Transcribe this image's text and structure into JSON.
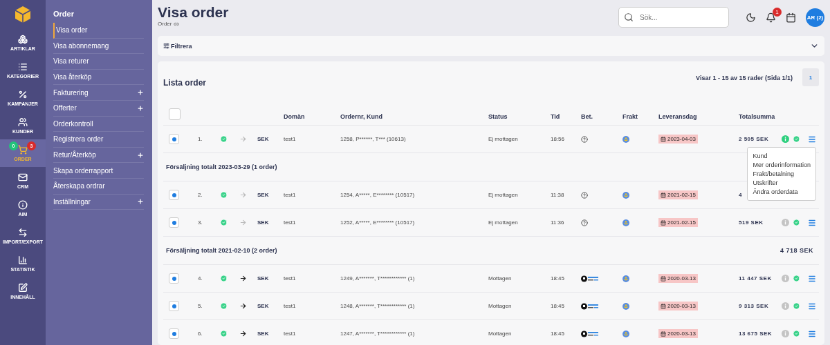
{
  "rail": {
    "items": [
      {
        "label": "ARTIKLAR",
        "selected": false
      },
      {
        "label": "KATEGORIER",
        "selected": false
      },
      {
        "label": "KAMPANJER",
        "selected": false
      },
      {
        "label": "KUNDER",
        "selected": false
      },
      {
        "label": "ORDER",
        "selected": true,
        "badges": [
          {
            "text": "0",
            "color": "#22c47a"
          },
          {
            "text": "3",
            "color": "#d92b2b"
          }
        ]
      },
      {
        "label": "CRM",
        "selected": false
      },
      {
        "label": "AIM",
        "selected": false
      },
      {
        "label": "IMPORT/EXPORT",
        "selected": false
      },
      {
        "label": "STATISTIK",
        "selected": false
      },
      {
        "label": "INNEHÅLL",
        "selected": false
      }
    ]
  },
  "submenu": {
    "title": "Order",
    "items": [
      {
        "label": "Visa order",
        "selected": true,
        "expandable": false
      },
      {
        "label": "Visa abonnemang",
        "selected": false,
        "expandable": false
      },
      {
        "label": "Visa returer",
        "selected": false,
        "expandable": false
      },
      {
        "label": "Visa återköp",
        "selected": false,
        "expandable": false
      },
      {
        "label": "Fakturering",
        "selected": false,
        "expandable": true
      },
      {
        "label": "Offerter",
        "selected": false,
        "expandable": true
      },
      {
        "label": "Orderkontroll",
        "selected": false,
        "expandable": false
      },
      {
        "label": "Registrera order",
        "selected": false,
        "expandable": false
      },
      {
        "label": "Retur/Återköp",
        "selected": false,
        "expandable": true
      },
      {
        "label": "Skapa orderrapport",
        "selected": false,
        "expandable": false
      },
      {
        "label": "Återskapa ordrar",
        "selected": false,
        "expandable": false
      },
      {
        "label": "Inställningar",
        "selected": false,
        "expandable": true
      }
    ]
  },
  "header": {
    "title": "Visa order",
    "breadcrumb": "Order",
    "search": {
      "placeholder": "Sök..."
    },
    "notifications": "1",
    "avatar": "AR (2)"
  },
  "filter": {
    "label": "Filtrera",
    "expanded": false
  },
  "list": {
    "title": "Lista order",
    "summary": "Visar 1 - 15 av 15 rader (Sida 1/1)",
    "pages": [
      {
        "label": "1",
        "selected": true
      }
    ],
    "header_checked": false,
    "columns": [
      "Domän",
      "Ordernr, Kund",
      "Status",
      "Tid",
      "Bet.",
      "Frakt",
      "Leveransdag",
      "Totalsumma"
    ],
    "sections": [
      {
        "kind": "row",
        "checked": true,
        "number": "1.",
        "arrow_active": false,
        "currency": "SEK",
        "domain": "test1",
        "order": "1258, P******, T*** (10613)",
        "status": "Ej mottagen",
        "time": "18:56",
        "invoiced": false,
        "delivery": "2023-04-03",
        "total": "2 505 SEK",
        "info_active": true,
        "actions_visible": true,
        "menu": [
          "Kund",
          "Mer orderinformation",
          "Frakt/betalning",
          "Utskrifter",
          "Ändra orderdata"
        ]
      },
      {
        "kind": "group",
        "label": "Försäljning totalt 2023-03-29 (1 order)"
      },
      {
        "kind": "row",
        "checked": true,
        "number": "2.",
        "arrow_active": false,
        "currency": "SEK",
        "domain": "test1",
        "order": "1254, A*****, E******** (10517)",
        "status": "Ej mottagen",
        "time": "11:38",
        "invoiced": false,
        "delivery": "2021-02-15",
        "total": "4",
        "actions_visible": false
      },
      {
        "kind": "row",
        "checked": true,
        "number": "3.",
        "arrow_active": false,
        "currency": "SEK",
        "domain": "test1",
        "order": "1252, A*****, E******** (10517)",
        "status": "Ej mottagen",
        "time": "11:36",
        "invoiced": false,
        "delivery": "2021-02-15",
        "total": "519 SEK",
        "info_active": false,
        "actions_visible": true
      },
      {
        "kind": "group",
        "label": "Försäljning totalt 2021-02-10 (2 order)",
        "total": "4 718 SEK"
      },
      {
        "kind": "row",
        "checked": true,
        "number": "4.",
        "arrow_active": true,
        "currency": "SEK",
        "domain": "test1",
        "order": "1249, A*******, T************ (1)",
        "status": "Mottagen",
        "time": "18:45",
        "invoiced": true,
        "delivery": "2020-03-13",
        "total": "11 447 SEK",
        "info_active": false,
        "actions_visible": true
      },
      {
        "kind": "row",
        "checked": true,
        "number": "5.",
        "arrow_active": true,
        "currency": "SEK",
        "domain": "test1",
        "order": "1248, A*******, T************ (1)",
        "status": "Mottagen",
        "time": "18:45",
        "invoiced": true,
        "delivery": "2020-03-13",
        "total": "9 313 SEK",
        "info_active": false,
        "actions_visible": true
      },
      {
        "kind": "row",
        "checked": true,
        "number": "6.",
        "arrow_active": true,
        "currency": "SEK",
        "domain": "test1",
        "order": "1247, A*******, T************ (1)",
        "status": "Mottagen",
        "time": "18:45",
        "invoiced": true,
        "delivery": "2020-03-13",
        "total": "13 675 SEK",
        "info_active": false,
        "actions_visible": true
      }
    ]
  }
}
